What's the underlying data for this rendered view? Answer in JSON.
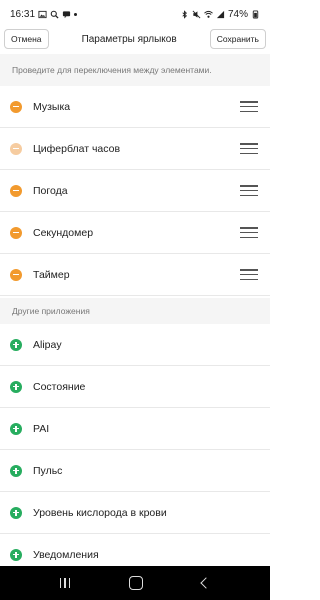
{
  "status_bar": {
    "time": "16:31",
    "battery": "74%",
    "left_icons": [
      "image-icon",
      "search-icon",
      "message-icon",
      "dot-icon"
    ],
    "right_icons": [
      "bluetooth-icon",
      "mute-icon",
      "wifi-icon",
      "signal-icon",
      "battery-icon"
    ]
  },
  "header": {
    "cancel_label": "Отмена",
    "title": "Параметры ярлыков",
    "save_label": "Сохранить"
  },
  "hint": "Проведите для переключения между элементами.",
  "active_items": [
    {
      "label": "Музыка",
      "disabled": false
    },
    {
      "label": "Циферблат часов",
      "disabled": true
    },
    {
      "label": "Погода",
      "disabled": false
    },
    {
      "label": "Секундомер",
      "disabled": false
    },
    {
      "label": "Таймер",
      "disabled": false
    }
  ],
  "other_section_title": "Другие приложения",
  "other_items": [
    {
      "label": "Alipay"
    },
    {
      "label": "Состояние"
    },
    {
      "label": "PAI"
    },
    {
      "label": "Пульс"
    },
    {
      "label": "Уровень кислорода в крови"
    },
    {
      "label": "Уведомления"
    }
  ],
  "colors": {
    "remove": "#f29a2e",
    "remove_disabled": "#f6cca0",
    "add": "#27ad5f"
  }
}
